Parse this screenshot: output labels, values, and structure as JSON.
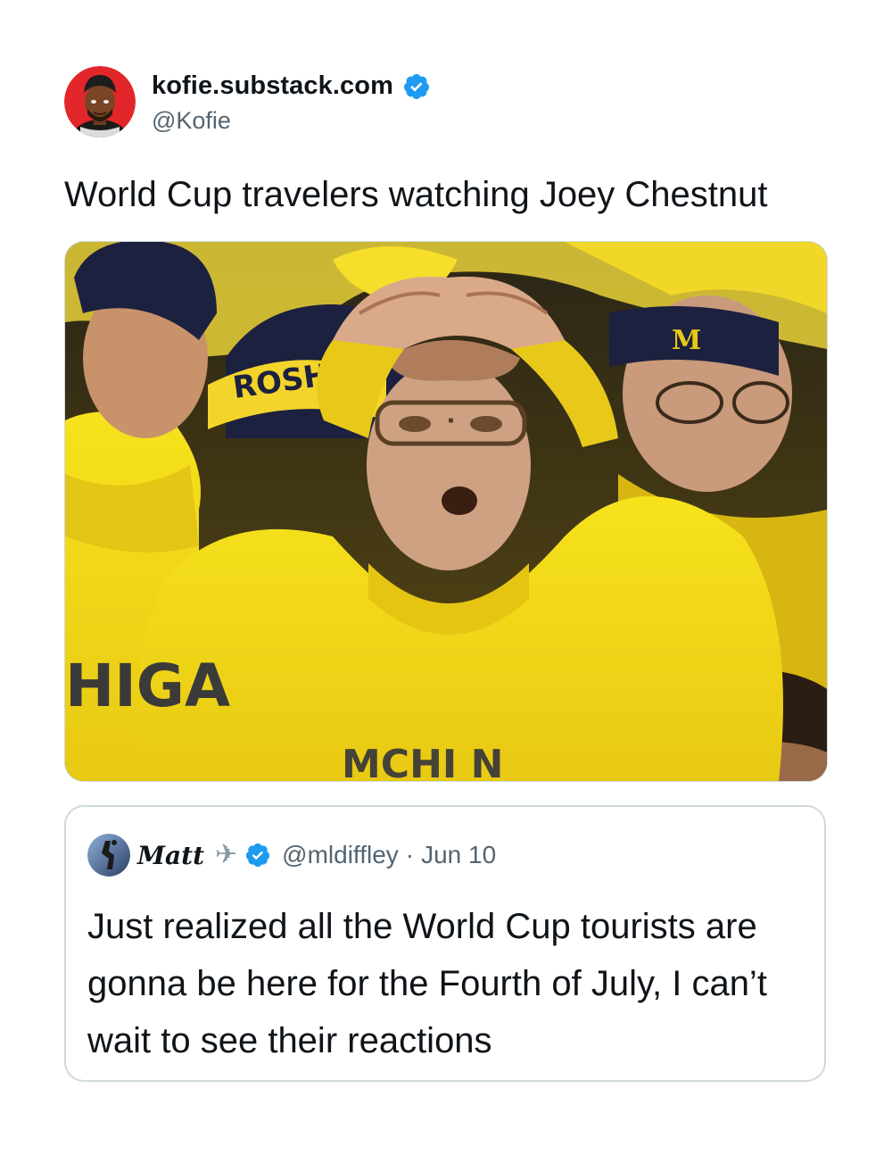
{
  "tweet": {
    "display_name": "kofie.substack.com",
    "handle": "@Kofie",
    "text": "World Cup travelers watching Joey Chestnut",
    "verified_icon": "verified-badge-icon"
  },
  "media": {
    "description_icon": "photo-icon",
    "sign_text": "ROSHEI",
    "shirt_text_left": "HIGA",
    "shirt_text_center": "MCHI N",
    "hat_logo": "M"
  },
  "quote": {
    "display_name": "Matt",
    "handle": "@mldiffley",
    "separator": "·",
    "date": "Jun 10",
    "text": "Just realized all the World Cup tourists are gonna be here for the Fourth of July, I can’t wait to see their reactions"
  },
  "colors": {
    "text": "#0f1419",
    "secondary": "#536471",
    "verified": "#1d9bf0",
    "border": "#cfd9de",
    "maize": "#f5e11a",
    "navy": "#1d2140"
  }
}
